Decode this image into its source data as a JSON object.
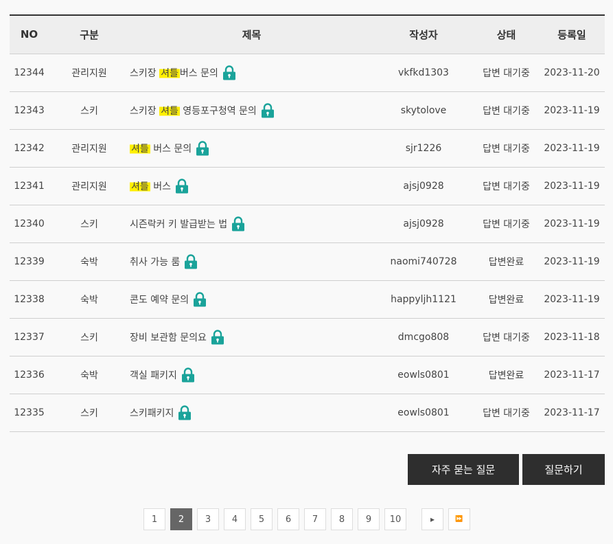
{
  "table": {
    "headers": {
      "no": "NO",
      "category": "구분",
      "title": "제목",
      "author": "작성자",
      "status": "상태",
      "date": "등록일"
    },
    "rows": [
      {
        "no": "12344",
        "category": "관리지원",
        "title_before": "스키장 ",
        "title_hl": "셔틀",
        "title_after": "버스 문의",
        "author": "vkfkd1303",
        "status": "답변 대기중",
        "date": "2023-11-20"
      },
      {
        "no": "12343",
        "category": "스키",
        "title_before": "스키장 ",
        "title_hl": "셔틀",
        "title_after": " 영등포구청역 문의",
        "author": "skytolove",
        "status": "답변 대기중",
        "date": "2023-11-19"
      },
      {
        "no": "12342",
        "category": "관리지원",
        "title_before": "",
        "title_hl": "셔틀",
        "title_after": " 버스 문의",
        "author": "sjr1226",
        "status": "답변 대기중",
        "date": "2023-11-19"
      },
      {
        "no": "12341",
        "category": "관리지원",
        "title_before": "",
        "title_hl": "셔틀",
        "title_after": " 버스",
        "author": "ajsj0928",
        "status": "답변 대기중",
        "date": "2023-11-19"
      },
      {
        "no": "12340",
        "category": "스키",
        "title_before": "시즌락커 키 발급받는 법",
        "title_hl": "",
        "title_after": "",
        "author": "ajsj0928",
        "status": "답변 대기중",
        "date": "2023-11-19"
      },
      {
        "no": "12339",
        "category": "숙박",
        "title_before": "취사 가능 룸",
        "title_hl": "",
        "title_after": "",
        "author": "naomi740728",
        "status": "답변완료",
        "date": "2023-11-19"
      },
      {
        "no": "12338",
        "category": "숙박",
        "title_before": "콘도 예약 문의",
        "title_hl": "",
        "title_after": "",
        "author": "happyljh1121",
        "status": "답변완료",
        "date": "2023-11-19"
      },
      {
        "no": "12337",
        "category": "스키",
        "title_before": "장비 보관함 문의요",
        "title_hl": "",
        "title_after": "",
        "author": "dmcgo808",
        "status": "답변 대기중",
        "date": "2023-11-18"
      },
      {
        "no": "12336",
        "category": "숙박",
        "title_before": "객실 패키지",
        "title_hl": "",
        "title_after": "",
        "author": "eowls0801",
        "status": "답변완료",
        "date": "2023-11-17"
      },
      {
        "no": "12335",
        "category": "스키",
        "title_before": "스키패키지",
        "title_hl": "",
        "title_after": "",
        "author": "eowls0801",
        "status": "답변 대기중",
        "date": "2023-11-17"
      }
    ]
  },
  "buttons": {
    "faq": "자주 묻는 질문",
    "ask": "질문하기"
  },
  "pagination": {
    "pages": [
      "1",
      "2",
      "3",
      "4",
      "5",
      "6",
      "7",
      "8",
      "9",
      "10"
    ],
    "current": "2",
    "next_icon": "▸",
    "last_icon": "⏩"
  },
  "colors": {
    "lock": "#1aa39a",
    "highlight": "#ffef00",
    "button_bg": "#2e2e2e",
    "active_page": "#666666"
  },
  "icons": {
    "lock": "lock-icon"
  }
}
